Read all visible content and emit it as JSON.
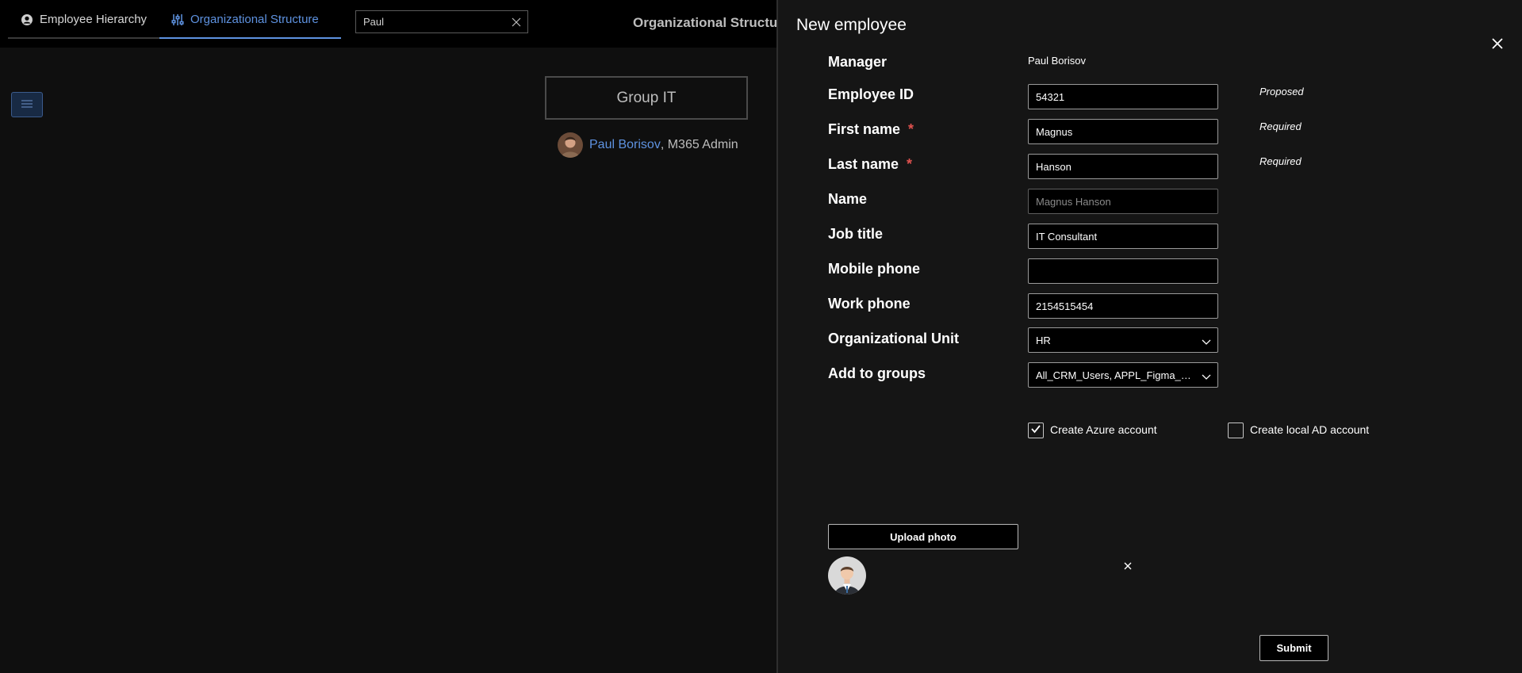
{
  "tabs": [
    {
      "label": "Employee Hierarchy",
      "icon": "user-circle-icon"
    },
    {
      "label": "Organizational Structure",
      "icon": "sliders-icon",
      "active": true
    }
  ],
  "search": {
    "value": "Paul",
    "clear_icon": "close-icon"
  },
  "background": {
    "title": "Organizational Structu",
    "group_name": "Group IT",
    "person": {
      "name": "Paul Borisov",
      "role": ", M365 Admin"
    }
  },
  "panel": {
    "title": "New employee",
    "close_icon": "close-icon",
    "manager": {
      "label": "Manager",
      "value": "Paul Borisov"
    },
    "fields": {
      "employee_id": {
        "label": "Employee ID",
        "value": "54321",
        "hint": "Proposed"
      },
      "first_name": {
        "label": "First name",
        "required_mark": "*",
        "value": "Magnus",
        "hint": "Required"
      },
      "last_name": {
        "label": "Last name",
        "required_mark": "*",
        "value": "Hanson",
        "hint": "Required"
      },
      "name": {
        "label": "Name",
        "value": "Magnus Hanson"
      },
      "job_title": {
        "label": "Job title",
        "value": "IT Consultant"
      },
      "mobile_phone": {
        "label": "Mobile phone",
        "value": ""
      },
      "work_phone": {
        "label": "Work phone",
        "value": "2154515454"
      },
      "org_unit": {
        "label": "Organizational Unit",
        "value": "HR"
      },
      "groups": {
        "label": "Add to groups",
        "value": "All_CRM_Users, APPL_Figma_d..."
      }
    },
    "checkboxes": {
      "azure": {
        "label": "Create Azure account",
        "checked": true
      },
      "local_ad": {
        "label": "Create local AD account",
        "checked": false
      }
    },
    "upload_label": "Upload photo",
    "submit_label": "Submit"
  },
  "colors": {
    "accent": "#5e92e0",
    "required": "#e0524f",
    "background": "#0f0f0f",
    "panel": "#151515"
  }
}
